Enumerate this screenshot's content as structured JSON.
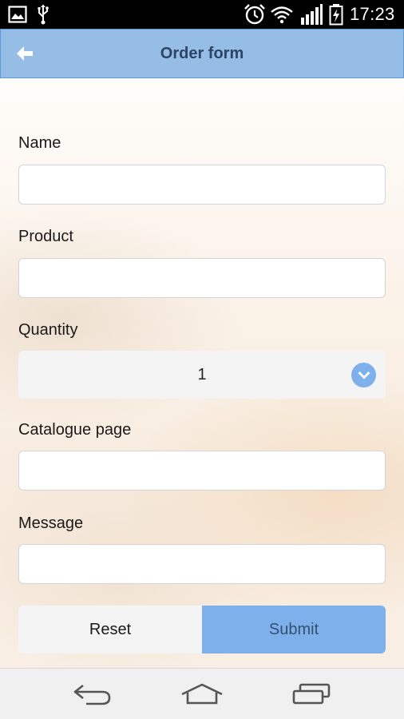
{
  "status_bar": {
    "time": "17:23",
    "icons": [
      "gallery-icon",
      "usb-icon",
      "alarm-icon",
      "wifi-icon",
      "signal-icon",
      "battery-charging-icon"
    ]
  },
  "header": {
    "title": "Order form",
    "back_icon": "back-arrow-icon",
    "color": "#95bde6"
  },
  "form": {
    "name": {
      "label": "Name",
      "value": "",
      "placeholder": ""
    },
    "product": {
      "label": "Product",
      "value": "",
      "placeholder": ""
    },
    "quantity": {
      "label": "Quantity",
      "value": "1"
    },
    "catalogue_page": {
      "label": "Catalogue page",
      "value": "",
      "placeholder": ""
    },
    "message": {
      "label": "Message",
      "value": "",
      "placeholder": ""
    }
  },
  "buttons": {
    "reset_label": "Reset",
    "submit_label": "Submit",
    "accent": "#7eb1ec"
  },
  "nav_bar": {
    "icons": [
      "back-nav-icon",
      "home-nav-icon",
      "recent-apps-icon"
    ]
  }
}
